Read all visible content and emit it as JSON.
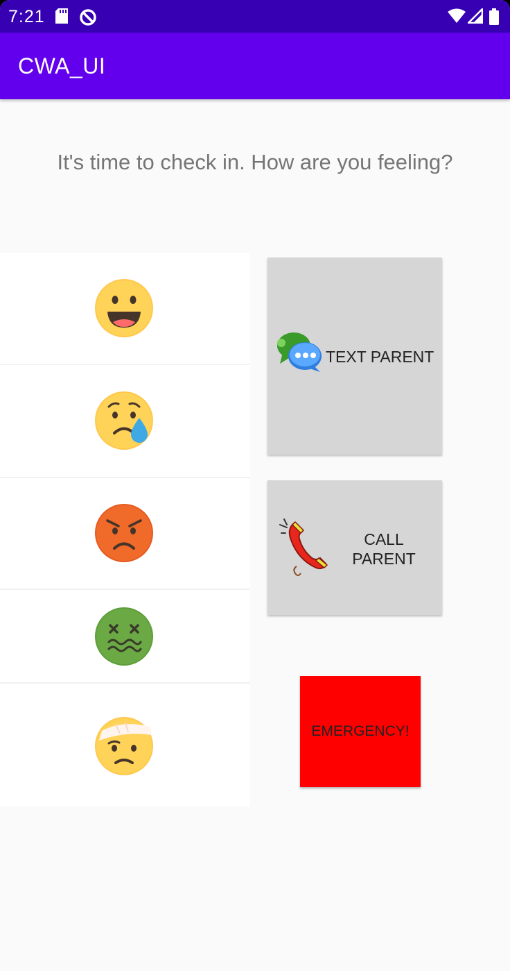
{
  "status_bar": {
    "time": "7:21",
    "icons": [
      "sd-card-icon",
      "data-saver-icon",
      "wifi-icon",
      "signal-icon",
      "battery-icon"
    ]
  },
  "app_bar": {
    "title": "CWA_UI"
  },
  "prompt": "It's time to check in. How are you feeling?",
  "moods": [
    {
      "icon": "grinning-face-icon"
    },
    {
      "icon": "crying-face-icon"
    },
    {
      "icon": "angry-face-icon"
    },
    {
      "icon": "sick-face-icon"
    },
    {
      "icon": "injured-face-icon"
    }
  ],
  "actions": {
    "text_parent": {
      "label": "TEXT PARENT",
      "icon": "chat-bubbles-icon"
    },
    "call_parent": {
      "label_line1": "CALL",
      "label_line2": "PARENT",
      "icon": "phone-icon"
    },
    "emergency": {
      "label": "EMERGENCY!"
    }
  },
  "colors": {
    "status_bar": "#3700b3",
    "app_bar": "#6200ee",
    "button": "#d6d6d6",
    "emergency": "#ff0000"
  }
}
